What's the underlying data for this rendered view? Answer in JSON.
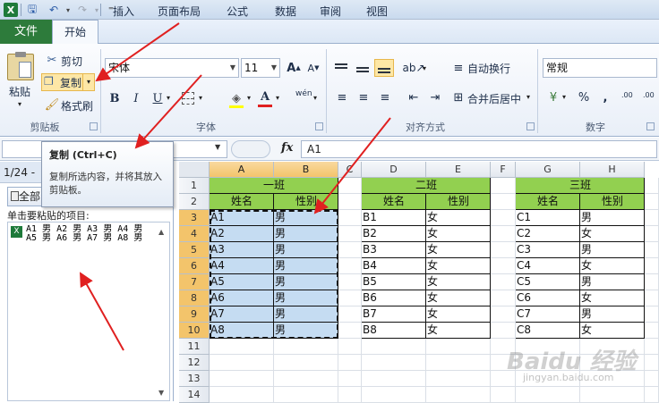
{
  "quick_access": {
    "logo": "X",
    "more": "⁼"
  },
  "tabs": [
    "文件",
    "开始",
    "插入",
    "页面布局",
    "公式",
    "数据",
    "审阅",
    "视图"
  ],
  "ribbon": {
    "clipboard": {
      "paste": "粘贴",
      "cut": "剪切",
      "copy": "复制",
      "format_painter": "格式刷",
      "group": "剪贴板"
    },
    "font": {
      "name": "宋体",
      "size": "11",
      "bold": "B",
      "italic": "I",
      "underline": "U",
      "wen": "wén",
      "group": "字体"
    },
    "alignment": {
      "wrap": "自动换行",
      "merge": "合并后居中",
      "group": "对齐方式"
    },
    "number": {
      "format": "常规",
      "percent": "%",
      "comma": ",",
      "group": "数字",
      "decimals": ".00"
    }
  },
  "formula_bar": {
    "fx": "fx",
    "value": "A1"
  },
  "tooltip": {
    "title": "复制 (Ctrl+C)",
    "body": "复制所选内容，并将其放入剪贴板。"
  },
  "pane": {
    "counter": "1/24 - ",
    "paste_all": "全部",
    "instruction": "单击要粘贴的项目:",
    "item": "A1 男 A2 男 A3 男 A4 男 A5 男 A6 男 A7 男 A8 男"
  },
  "grid": {
    "columns": [
      "A",
      "B",
      "C",
      "D",
      "E",
      "F",
      "G",
      "H"
    ],
    "rows": [
      "1",
      "2",
      "3",
      "4",
      "5",
      "6",
      "7",
      "8",
      "9",
      "10",
      "11",
      "12",
      "13",
      "14"
    ],
    "class1": {
      "title": "一班",
      "header": [
        "姓名",
        "性别"
      ],
      "names": [
        "A1",
        "A2",
        "A3",
        "A4",
        "A5",
        "A6",
        "A7",
        "A8"
      ],
      "genders": [
        "男",
        "男",
        "男",
        "男",
        "男",
        "男",
        "男",
        "男"
      ]
    },
    "class2": {
      "title": "二班",
      "header": [
        "姓名",
        "性别"
      ],
      "names": [
        "B1",
        "B2",
        "B3",
        "B4",
        "B5",
        "B6",
        "B7",
        "B8"
      ],
      "genders": [
        "女",
        "女",
        "女",
        "女",
        "女",
        "女",
        "女",
        "女"
      ]
    },
    "class3": {
      "title": "三班",
      "header": [
        "姓名",
        "性别"
      ],
      "names": [
        "C1",
        "C2",
        "C3",
        "C4",
        "C5",
        "C6",
        "C7",
        "C8"
      ],
      "genders": [
        "男",
        "女",
        "男",
        "女",
        "男",
        "女",
        "男",
        "女"
      ]
    }
  },
  "watermark": {
    "main": "Baidu 经验",
    "sub": "jingyan.baidu.com"
  },
  "colors": {
    "file_tab": "#2d7b3b",
    "header_green": "#92d050",
    "selection_blue": "#c5dcf2",
    "arrow_red": "#e02020"
  }
}
